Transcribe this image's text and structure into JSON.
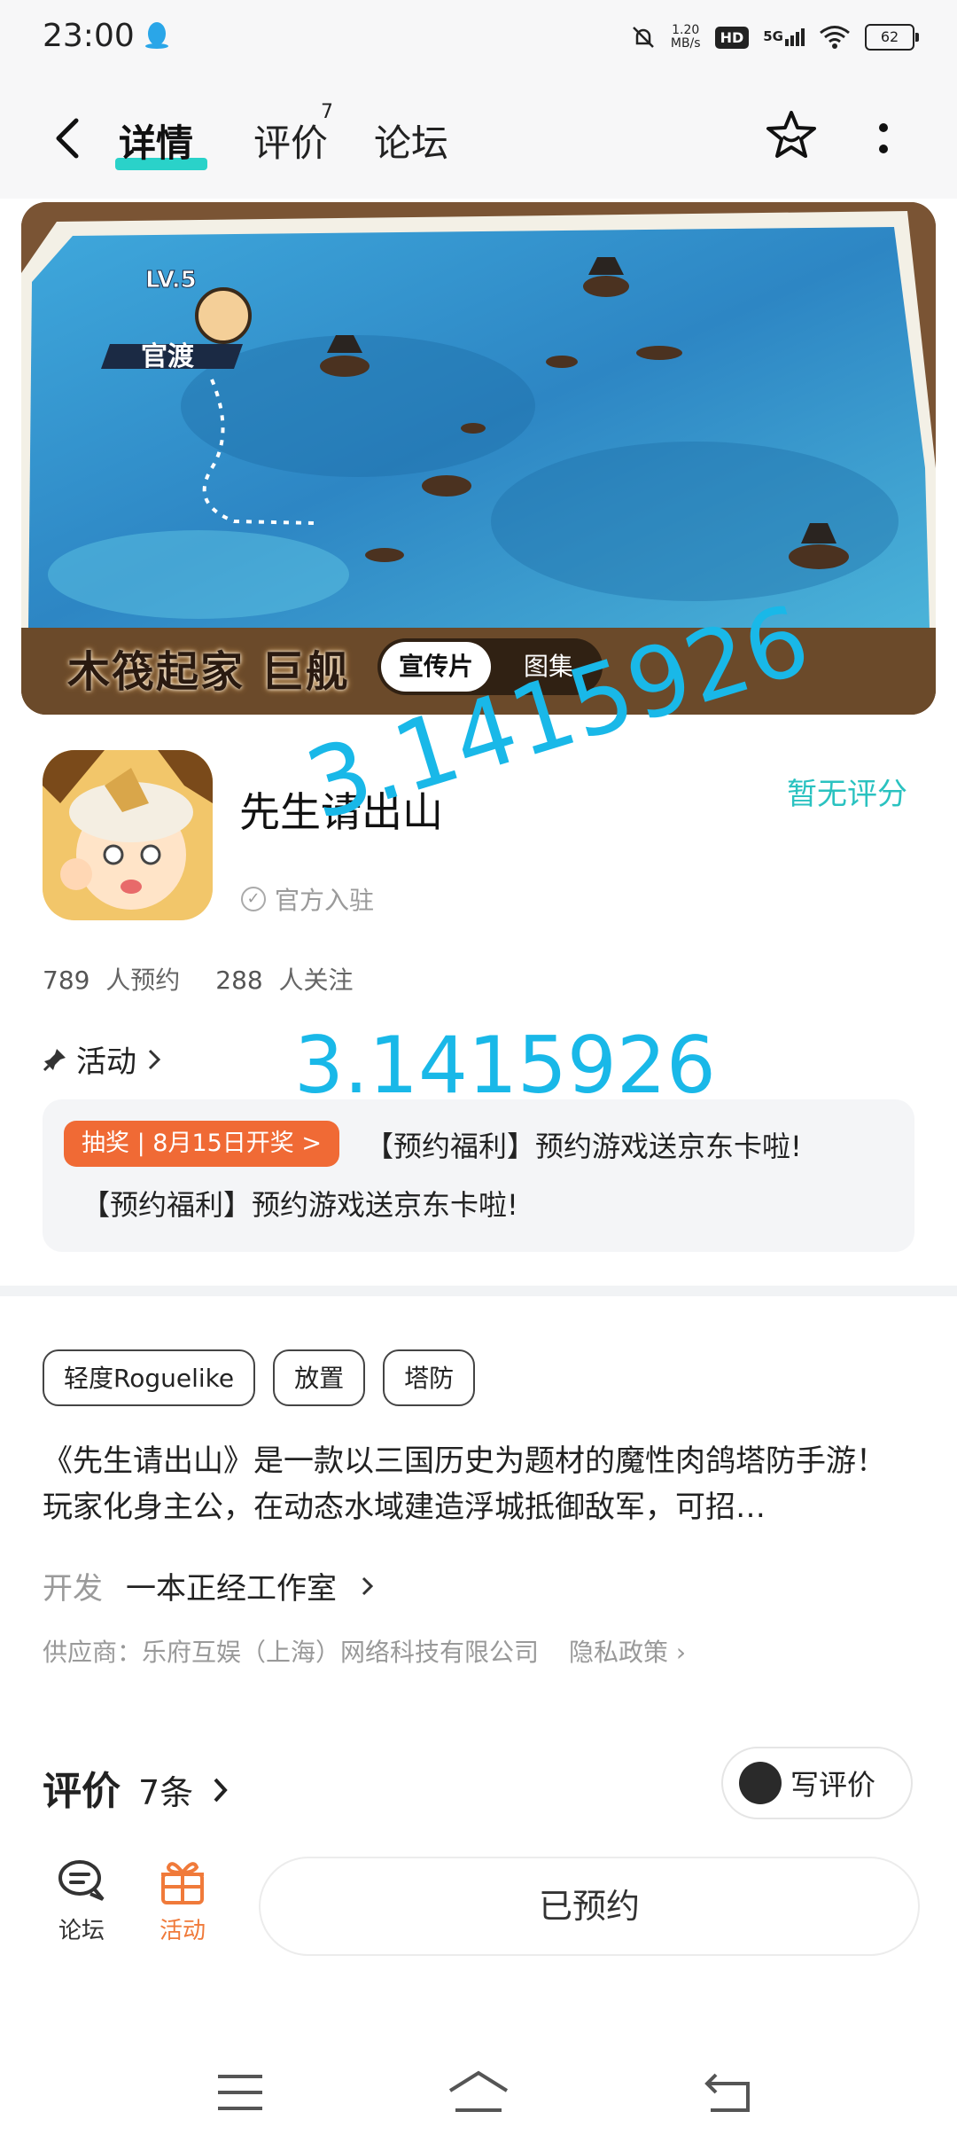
{
  "status_bar": {
    "time": "23:00",
    "speed_value": "1.20",
    "speed_unit": "MB/s",
    "hd": "HD",
    "network": "5G",
    "battery": "62"
  },
  "nav": {
    "tabs": [
      {
        "label": "详情"
      },
      {
        "label": "评价",
        "badge": "7"
      },
      {
        "label": "论坛"
      }
    ]
  },
  "banner": {
    "caption": "木筏起家 巨舰",
    "map_label": "官渡",
    "map_level": "LV.5",
    "media_tabs": [
      "宣传片",
      "图集"
    ]
  },
  "app": {
    "name": "先生请出山",
    "rating": "暂无评分",
    "official": "官方入驻",
    "reservations": "789",
    "reservations_label": "人预约",
    "followers": "288",
    "followers_label": "人关注"
  },
  "watermarks": [
    "3.1415926",
    "3.1415926"
  ],
  "activity": {
    "header": "活动",
    "badge": "抽奖 | 8月15日开奖 >",
    "title": "【预约福利】预约游戏送京东卡啦!",
    "title_2": "【预约福利】预约游戏送京东卡啦!"
  },
  "tags": [
    "轻度Roguelike",
    "放置",
    "塔防"
  ],
  "description": "《先生请出山》是一款以三国历史为题材的魔性肉鸽塔防手游！ 玩家化身主公，在动态水域建造浮城抵御敌军，可招…",
  "developer": {
    "label": "开发",
    "name": "一本正经工作室"
  },
  "supplier": {
    "text": "供应商：乐府互娱（上海）网络科技有限公司",
    "privacy": "隐私政策"
  },
  "reviews": {
    "title": "评价",
    "count": "7条",
    "write": "写评价"
  },
  "bottom_bar": {
    "forum": "论坛",
    "activity": "活动",
    "reserved": "已预约"
  },
  "colors": {
    "accent": "#2ad2c9",
    "rating": "#2ac2c0",
    "badge": "#f06a35",
    "activity_tab": "#f07a3a",
    "watermark": "#19b8e8"
  }
}
